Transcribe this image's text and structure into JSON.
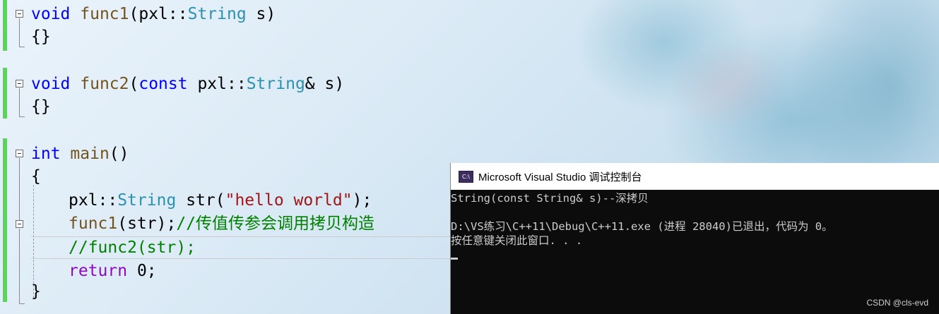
{
  "editor": {
    "lines": [
      {
        "tokens": [
          {
            "c": "kw",
            "t": "void"
          },
          {
            "c": "",
            "t": " "
          },
          {
            "c": "fn",
            "t": "func1"
          },
          {
            "c": "",
            "t": "(pxl::"
          },
          {
            "c": "ty",
            "t": "String"
          },
          {
            "c": "",
            "t": " s)"
          }
        ]
      },
      {
        "tokens": [
          {
            "c": "",
            "t": "{}"
          }
        ]
      },
      {
        "tokens": [
          {
            "c": "kw",
            "t": "void"
          },
          {
            "c": "",
            "t": " "
          },
          {
            "c": "fn",
            "t": "func2"
          },
          {
            "c": "",
            "t": "("
          },
          {
            "c": "kw",
            "t": "const"
          },
          {
            "c": "",
            "t": " pxl::"
          },
          {
            "c": "ty",
            "t": "String"
          },
          {
            "c": "",
            "t": "& s)"
          }
        ]
      },
      {
        "tokens": [
          {
            "c": "",
            "t": "{}"
          }
        ]
      },
      {
        "tokens": [
          {
            "c": "kw",
            "t": "int"
          },
          {
            "c": "",
            "t": " "
          },
          {
            "c": "fn",
            "t": "main"
          },
          {
            "c": "",
            "t": "()"
          }
        ]
      },
      {
        "tokens": [
          {
            "c": "",
            "t": "{"
          }
        ]
      },
      {
        "tokens": [
          {
            "c": "",
            "t": "pxl::"
          },
          {
            "c": "ty",
            "t": "String"
          },
          {
            "c": "",
            "t": " str("
          },
          {
            "c": "str",
            "t": "\"hello world\""
          },
          {
            "c": "",
            "t": ");"
          }
        ]
      },
      {
        "tokens": [
          {
            "c": "fn",
            "t": "func1"
          },
          {
            "c": "",
            "t": "(str);"
          },
          {
            "c": "cm",
            "t": "//传值传参会调用拷贝构造"
          }
        ]
      },
      {
        "tokens": [
          {
            "c": "cm",
            "t": "//func2(str);"
          }
        ]
      },
      {
        "tokens": [
          {
            "c": "kw2",
            "t": "return"
          },
          {
            "c": "",
            "t": " 0;"
          }
        ]
      },
      {
        "tokens": [
          {
            "c": "",
            "t": "}"
          }
        ]
      }
    ]
  },
  "console": {
    "title": "Microsoft Visual Studio 调试控制台",
    "icon": "console-app-icon",
    "icon_text": "C:\\",
    "output": [
      "String(const String& s)--深拷贝",
      "",
      "D:\\VS练习\\C++11\\Debug\\C++11.exe (进程 28040)已退出，代码为 0。",
      "按任意键关闭此窗口. . ."
    ]
  },
  "watermark": "CSDN @cls-evd",
  "colors": {
    "keyword": "#0000ff",
    "function": "#74531f",
    "type": "#2b91af",
    "string": "#a31515",
    "comment": "#008000",
    "control_keyword": "#8f08c4",
    "change_bar": "#5ed25e",
    "console_bg": "#0c0c0c"
  }
}
